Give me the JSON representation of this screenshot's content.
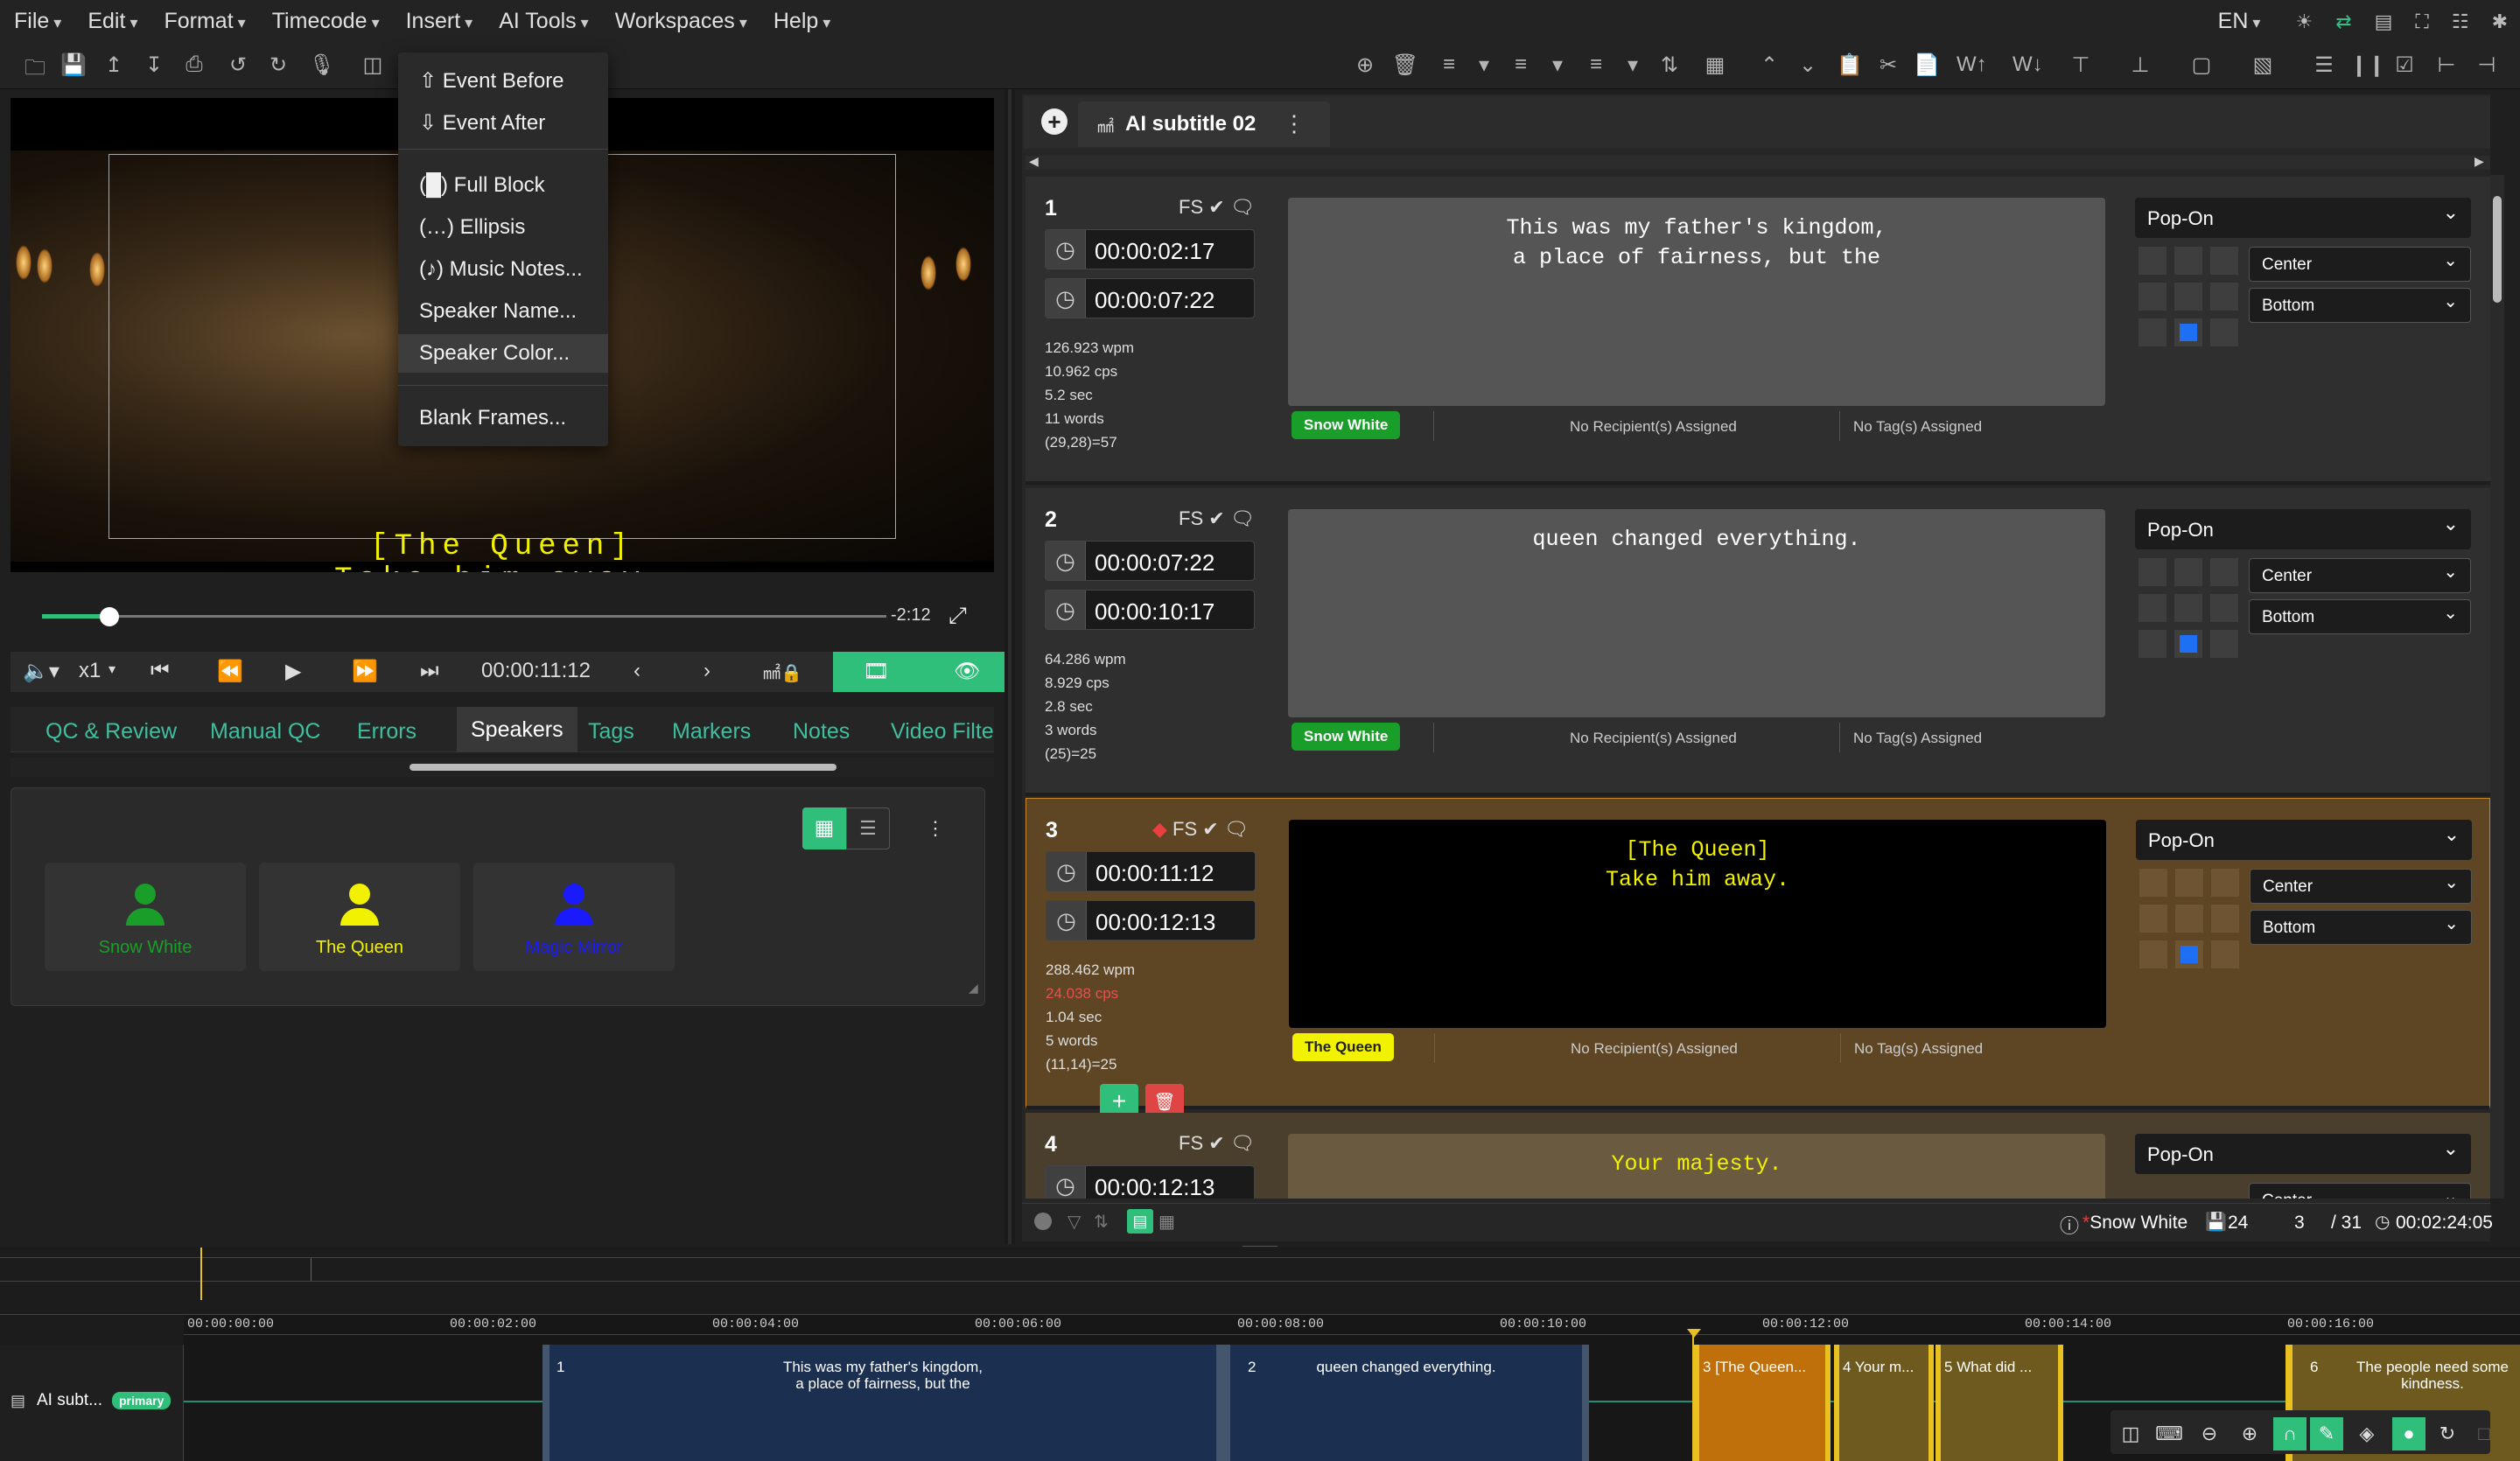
{
  "menu": [
    "File",
    "Edit",
    "Format",
    "Timecode",
    "Insert",
    "AI Tools",
    "Workspaces",
    "Help"
  ],
  "menu_right": {
    "lang": "EN"
  },
  "insert_menu": {
    "items": [
      {
        "label": "Event Before",
        "icon": "arrow-up-circle-icon"
      },
      {
        "label": "Event After",
        "icon": "arrow-down-circle-icon"
      },
      {
        "label": "(█) Full Block"
      },
      {
        "label": "(…) Ellipsis"
      },
      {
        "label": "(♪) Music Notes..."
      },
      {
        "label": "Speaker Name..."
      },
      {
        "label": "Speaker Color...",
        "highlighted": true
      },
      {
        "label": "Blank Frames..."
      }
    ]
  },
  "video": {
    "subtitle_line1": "[The Queen]",
    "subtitle_line2": "Take him away.",
    "remaining": "-2:12",
    "progress": 0.08,
    "speed": "x1",
    "timecode": "00:00:11:12"
  },
  "left_tabs": [
    "QC & Review",
    "Manual QC",
    "Errors",
    "Speakers",
    "Tags",
    "Markers",
    "Notes",
    "Video Filte"
  ],
  "active_left_tab": "Speakers",
  "speakers": [
    {
      "name": "Snow White",
      "color": "#1a9e2a"
    },
    {
      "name": "The Queen",
      "color": "#f2f200"
    },
    {
      "name": "Magic Mirror",
      "color": "#1a1aff"
    }
  ],
  "subtitle_tab": {
    "title": "AI subtitle 02"
  },
  "events": [
    {
      "num": "1",
      "fs": "FS",
      "start": "00:00:02:17",
      "end": "00:00:07:22",
      "stats": [
        "126.923 wpm",
        "10.962 cps",
        "5.2 sec",
        "11 words",
        "(29,28)=57"
      ],
      "text": "This was my father's kingdom,\na place of fairness, but the",
      "speaker": "Snow White",
      "recipients": "No Recipient(s) Assigned",
      "tags": "No Tag(s) Assigned",
      "mode": "Pop-On",
      "halign": "Center",
      "valign": "Bottom"
    },
    {
      "num": "2",
      "fs": "FS",
      "start": "00:00:07:22",
      "end": "00:00:10:17",
      "stats": [
        "64.286 wpm",
        "8.929 cps",
        "2.8 sec",
        "3 words",
        "(25)=25"
      ],
      "text": "queen changed everything.",
      "speaker": "Snow White",
      "recipients": "No Recipient(s) Assigned",
      "tags": "No Tag(s) Assigned",
      "mode": "Pop-On",
      "halign": "Center",
      "valign": "Bottom"
    },
    {
      "num": "3",
      "fs": "FS",
      "start": "00:00:11:12",
      "end": "00:00:12:13",
      "stats": [
        "288.462 wpm",
        "24.038 cps",
        "1.04 sec",
        "5 words",
        "(11,14)=25"
      ],
      "text": "[The Queen]\nTake him away.",
      "speaker": "The Queen",
      "recipients": "No Recipient(s) Assigned",
      "tags": "No Tag(s) Assigned",
      "mode": "Pop-On",
      "halign": "Center",
      "valign": "Bottom"
    },
    {
      "num": "4",
      "fs": "FS",
      "start": "00:00:12:13",
      "text": "Your majesty.",
      "mode": "Pop-On",
      "halign": "Center"
    }
  ],
  "status": {
    "speaker": "Snow White",
    "frames": "24",
    "current": "3",
    "total": "/ 31",
    "duration": "00:02:24:05"
  },
  "timeline": {
    "track_label": "AI subt...",
    "track_badge": "primary",
    "ticks": [
      "00:00:00:00",
      "00:00:02:00",
      "00:00:04:00",
      "00:00:06:00",
      "00:00:08:00",
      "00:00:10:00",
      "00:00:12:00",
      "00:00:14:00",
      "00:00:16:00"
    ],
    "blocks": [
      {
        "num": "1",
        "text": "This was my father's kingdom,\na place of fairness, but the"
      },
      {
        "num": "2",
        "text": "queen changed everything."
      },
      {
        "num": "3",
        "text": "[The Queen..."
      },
      {
        "num": "4",
        "text": "Your m..."
      },
      {
        "num": "5",
        "text": "What did ..."
      },
      {
        "num": "6",
        "text": "The people need some\nkindness."
      }
    ]
  }
}
